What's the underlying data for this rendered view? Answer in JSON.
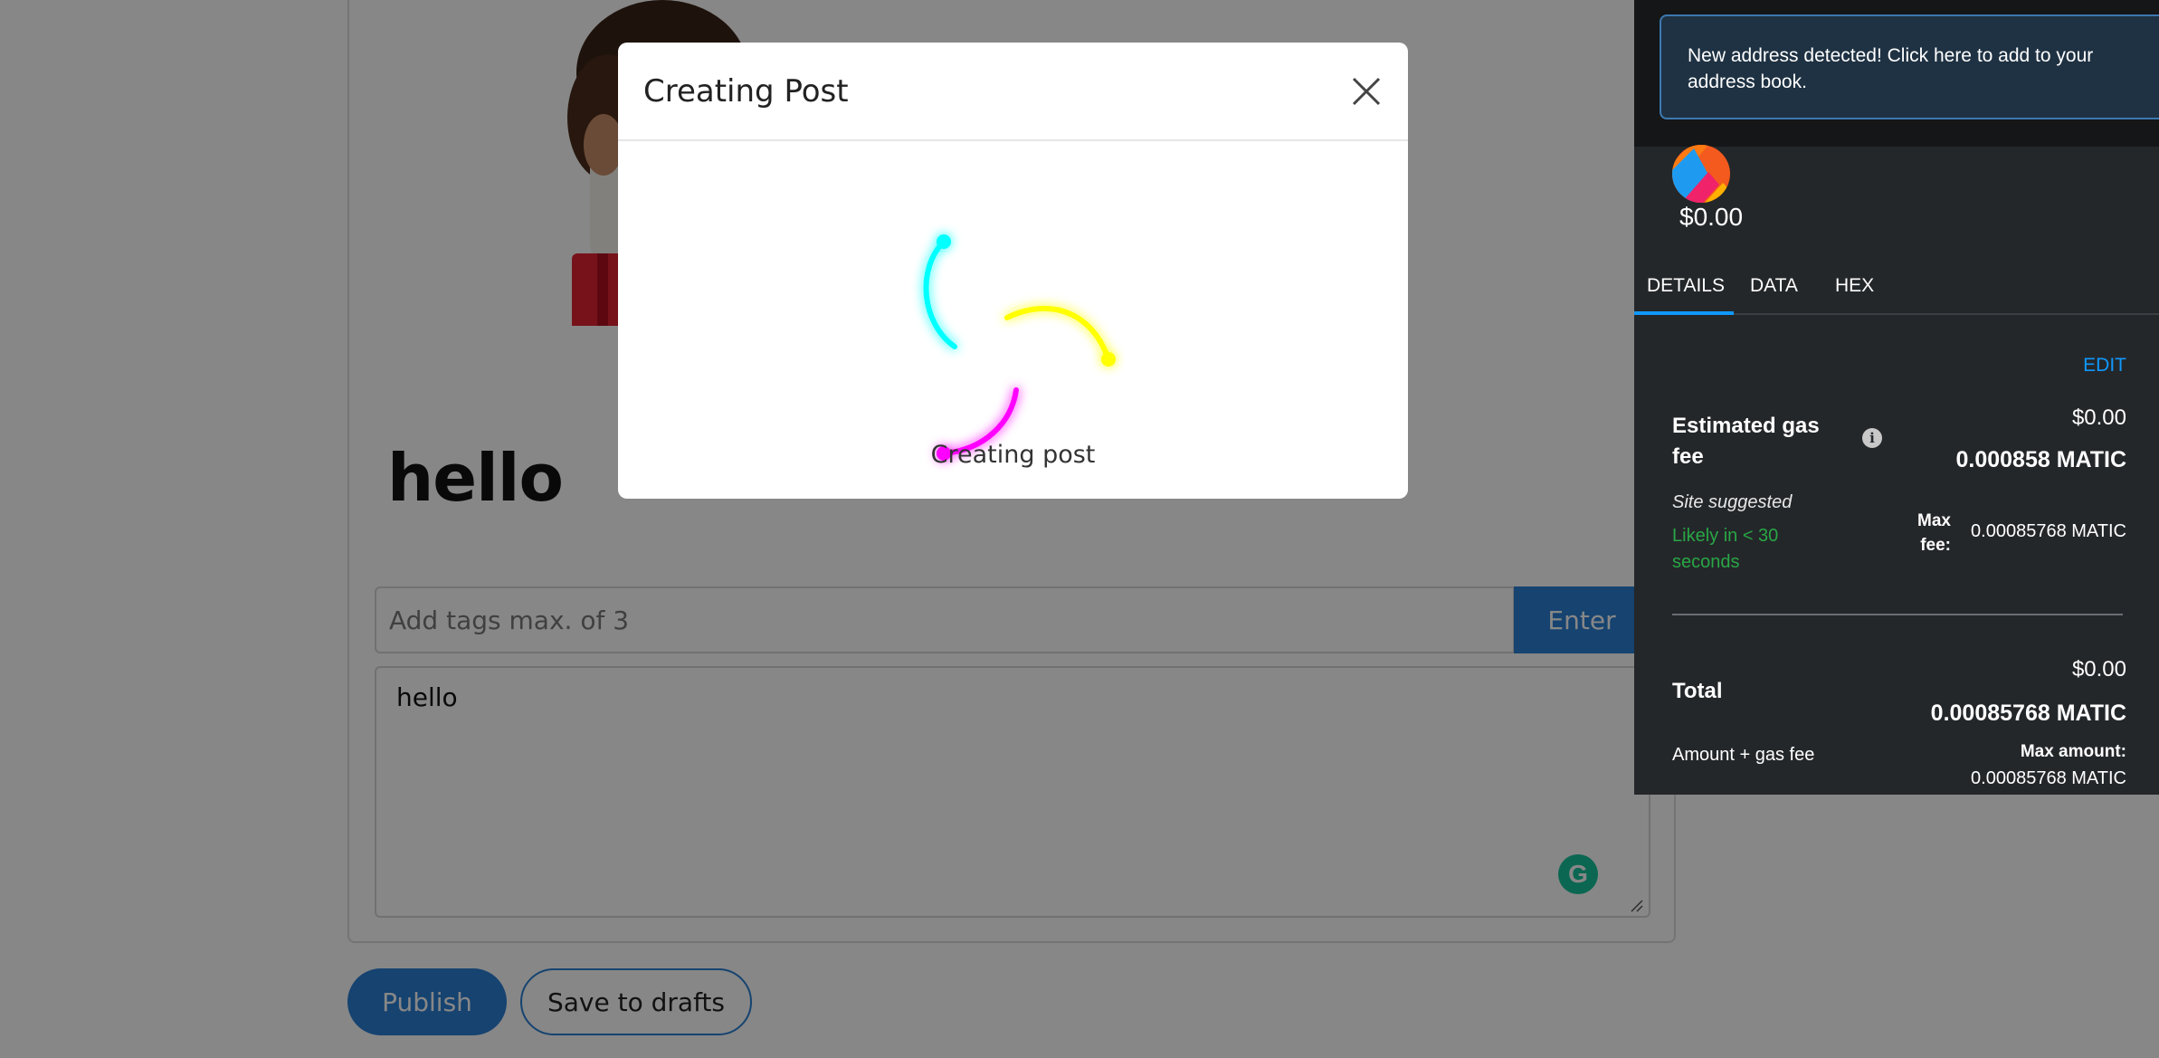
{
  "page": {
    "post_title": "hello",
    "tags_placeholder": "Add tags max. of 3",
    "enter_label": "Enter",
    "body_text": "hello",
    "grammarly_letter": "G",
    "publish_label": "Publish",
    "drafts_label": "Save to drafts"
  },
  "modal": {
    "title": "Creating Post",
    "status": "Creating post",
    "spinner_colors": [
      "#00ffff",
      "#ffff00",
      "#ff00ff"
    ]
  },
  "wallet": {
    "notice": "New address detected! Click here to add to your address book.",
    "balance": "$0.00",
    "tabs": [
      {
        "label": "DETAILS",
        "active": true
      },
      {
        "label": "DATA",
        "active": false
      },
      {
        "label": "HEX",
        "active": false
      }
    ],
    "edit_label": "EDIT",
    "gas": {
      "label": "Estimated gas fee",
      "info_icon": "i",
      "usd": "$0.00",
      "matic": "0.000858 MATIC",
      "site_suggested": "Site suggested",
      "likely": "Likely in < 30 seconds",
      "max_fee_label": "Max fee:",
      "max_fee_value": "0.00085768 MATIC"
    },
    "total": {
      "label": "Total",
      "usd": "$0.00",
      "matic": "0.00085768 MATIC",
      "amount_label": "Amount + gas fee",
      "max_amount_label": "Max amount:",
      "max_amount_value": "0.00085768 MATIC"
    },
    "accent_color": "#1098fc",
    "success_color": "#28a745"
  }
}
